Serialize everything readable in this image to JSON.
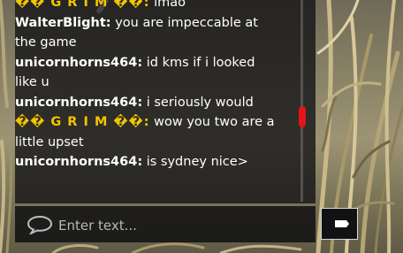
{
  "chat": {
    "messages": [
      {
        "author": "�� G R I M ��",
        "author_style": "gold",
        "text": "lmao"
      },
      {
        "author": "WalterBlight",
        "author_style": "white",
        "text": "you are impeccable at the game"
      },
      {
        "author": "unicornhorns464",
        "author_style": "white",
        "text": "id kms if i looked like u"
      },
      {
        "author": "unicornhorns464",
        "author_style": "white",
        "text": "i seriously would"
      },
      {
        "author": "�� G R I M ��",
        "author_style": "gold",
        "text": "wow you two are a little upset"
      },
      {
        "author": "unicornhorns464",
        "author_style": "white",
        "text": "is sydney nice>"
      }
    ],
    "author_separator": ":"
  },
  "input": {
    "placeholder": "Enter text..."
  },
  "icons": {
    "chat": "speech-bubble-icon",
    "send": "send-icon"
  },
  "colors": {
    "author_gold": "#f2c500",
    "scroll_thumb": "#e3141a",
    "panel_bg": "rgba(20,20,22,0.80)"
  }
}
